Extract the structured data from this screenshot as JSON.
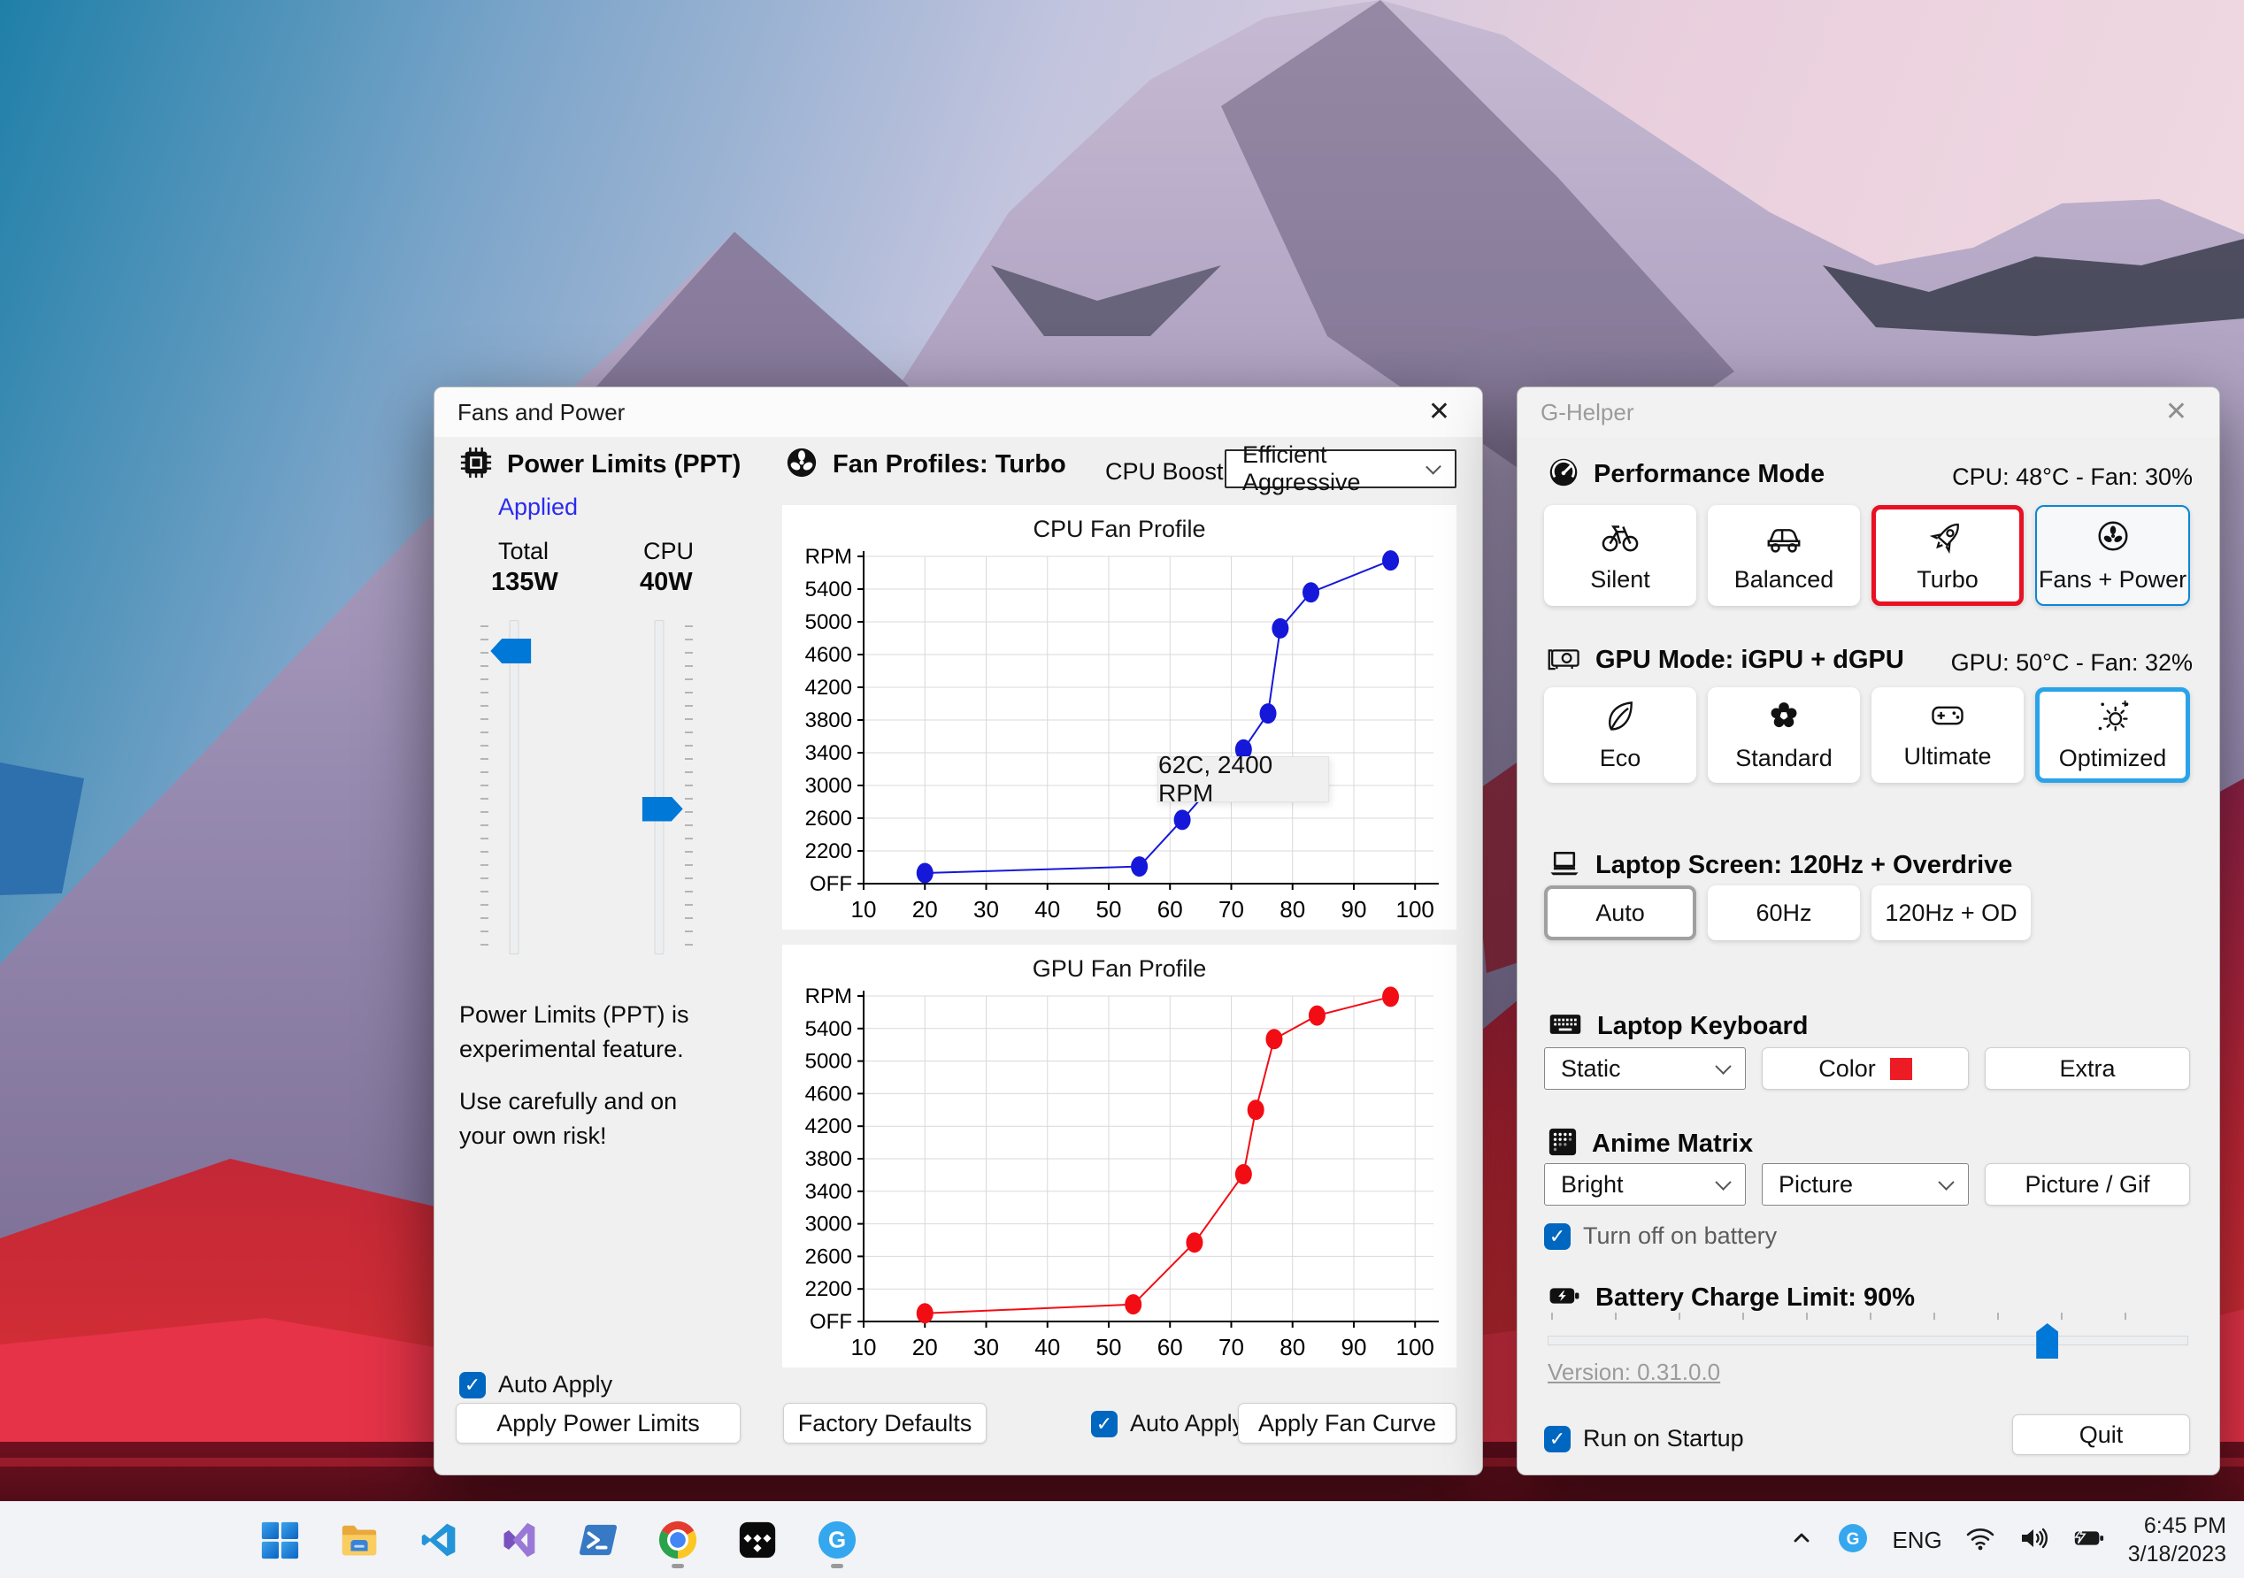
{
  "icons": {
    "close": "✕",
    "check": "✓"
  },
  "colors": {
    "selection_red": "#e81123",
    "selection_blue": "#2aa3e8",
    "checkbox_blue": "#0067c0",
    "slider_blue": "#0078d7",
    "applied_blue": "#2b2bf0",
    "keyboard_color_swatch": "#ed1c24",
    "cpu_line": "#1518d8",
    "gpu_line": "#f20d14"
  },
  "fans_window": {
    "title": "Fans and Power",
    "power_limits": {
      "heading": "Power Limits (PPT)",
      "status": "Applied",
      "total_label": "Total",
      "total_value": "135W",
      "cpu_label": "CPU",
      "cpu_value": "40W",
      "total_slider_fraction": 0.06,
      "cpu_slider_fraction": 0.57,
      "note1": "Power Limits (PPT) is experimental feature.",
      "note2": "Use carefully and on your own risk!",
      "auto_apply": "Auto Apply",
      "apply_button": "Apply Power Limits"
    },
    "fan_profiles": {
      "heading": "Fan Profiles: Turbo",
      "cpu_boost_label": "CPU Boost",
      "cpu_boost_value": "Efficient Aggressive",
      "factory_defaults_button": "Factory Defaults",
      "auto_apply": "Auto Apply",
      "apply_button": "Apply Fan Curve",
      "tooltip": "62C, 2400 RPM"
    }
  },
  "chart_data": [
    {
      "type": "line",
      "title": "CPU Fan Profile",
      "xlabel": "",
      "ylabel": "RPM",
      "xlim": [
        10,
        103
      ],
      "ylim": [
        1800,
        5800
      ],
      "grid": true,
      "x_ticks": [
        10,
        20,
        30,
        40,
        50,
        60,
        70,
        80,
        90,
        100
      ],
      "y_ticks": [
        {
          "v": 1800,
          "label": "OFF"
        },
        {
          "v": 2200,
          "label": "2200"
        },
        {
          "v": 2600,
          "label": "2600"
        },
        {
          "v": 3000,
          "label": "3000"
        },
        {
          "v": 3400,
          "label": "3400"
        },
        {
          "v": 3800,
          "label": "3800"
        },
        {
          "v": 4200,
          "label": "4200"
        },
        {
          "v": 4600,
          "label": "4600"
        },
        {
          "v": 5000,
          "label": "5000"
        },
        {
          "v": 5400,
          "label": "5400"
        },
        {
          "v": 5800,
          "label": "RPM"
        }
      ],
      "series": [
        {
          "name": "CPU fan curve",
          "color": "#1518d8",
          "points": [
            [
              20,
              1930
            ],
            [
              55,
              2010
            ],
            [
              62,
              2580
            ],
            [
              72,
              3440
            ],
            [
              76,
              3880
            ],
            [
              78,
              4920
            ],
            [
              83,
              5360
            ],
            [
              96,
              5750
            ]
          ]
        }
      ],
      "annotation": "62C, 2400 RPM"
    },
    {
      "type": "line",
      "title": "GPU Fan Profile",
      "xlabel": "",
      "ylabel": "RPM",
      "xlim": [
        10,
        103
      ],
      "ylim": [
        1800,
        5800
      ],
      "grid": true,
      "x_ticks": [
        10,
        20,
        30,
        40,
        50,
        60,
        70,
        80,
        90,
        100
      ],
      "y_ticks": [
        {
          "v": 1800,
          "label": "OFF"
        },
        {
          "v": 2200,
          "label": "2200"
        },
        {
          "v": 2600,
          "label": "2600"
        },
        {
          "v": 3000,
          "label": "3000"
        },
        {
          "v": 3400,
          "label": "3400"
        },
        {
          "v": 3800,
          "label": "3800"
        },
        {
          "v": 4200,
          "label": "4200"
        },
        {
          "v": 4600,
          "label": "4600"
        },
        {
          "v": 5000,
          "label": "5000"
        },
        {
          "v": 5400,
          "label": "5400"
        },
        {
          "v": 5800,
          "label": "RPM"
        }
      ],
      "series": [
        {
          "name": "GPU fan curve",
          "color": "#f20d14",
          "points": [
            [
              20,
              1900
            ],
            [
              54,
              2010
            ],
            [
              64,
              2770
            ],
            [
              72,
              3610
            ],
            [
              74,
              4400
            ],
            [
              77,
              5270
            ],
            [
              84,
              5560
            ],
            [
              96,
              5790
            ]
          ]
        }
      ]
    }
  ],
  "ghelper": {
    "title": "G-Helper",
    "performance": {
      "heading": "Performance Mode",
      "status": "CPU: 48°C -  Fan: 30%",
      "buttons": [
        {
          "label": "Silent",
          "icon": "bicycle-icon"
        },
        {
          "label": "Balanced",
          "icon": "car-icon"
        },
        {
          "label": "Turbo",
          "icon": "rocket-icon",
          "selected": "red"
        },
        {
          "label": "Fans + Power",
          "icon": "fan-icon",
          "selected": "outline"
        }
      ]
    },
    "gpu_mode": {
      "heading": "GPU Mode: iGPU + dGPU",
      "status": "GPU: 50°C -  Fan: 32%",
      "buttons": [
        {
          "label": "Eco",
          "icon": "leaf-icon"
        },
        {
          "label": "Standard",
          "icon": "flower-icon"
        },
        {
          "label": "Ultimate",
          "icon": "gamepad-icon"
        },
        {
          "label": "Optimized",
          "icon": "sparkle-gear-icon",
          "selected": "blue"
        }
      ]
    },
    "screen": {
      "heading": "Laptop Screen: 120Hz + Overdrive",
      "buttons": [
        {
          "label": "Auto",
          "selected": "gray"
        },
        {
          "label": "60Hz"
        },
        {
          "label": "120Hz + OD"
        }
      ]
    },
    "keyboard": {
      "heading": "Laptop Keyboard",
      "mode": "Static",
      "color_button": "Color",
      "extra_button": "Extra"
    },
    "matrix": {
      "heading": "Anime Matrix",
      "brightness": "Bright",
      "running_mode": "Picture",
      "picture_button": "Picture / Gif",
      "battery_checkbox": "Turn off on battery"
    },
    "battery": {
      "heading": "Battery Charge Limit: 90%",
      "slider_fraction": 0.79
    },
    "version": "Version: 0.31.0.0",
    "run_on_startup": "Run on Startup",
    "quit_button": "Quit"
  },
  "taskbar": {
    "apps": [
      {
        "name": "start"
      },
      {
        "name": "file-explorer"
      },
      {
        "name": "vscode"
      },
      {
        "name": "visual-studio"
      },
      {
        "name": "powershell"
      },
      {
        "name": "chrome",
        "running": true
      },
      {
        "name": "tidal"
      },
      {
        "name": "g-helper",
        "running": true
      }
    ],
    "tray": {
      "language": "ENG",
      "time": "6:45 PM",
      "date": "3/18/2023"
    }
  }
}
